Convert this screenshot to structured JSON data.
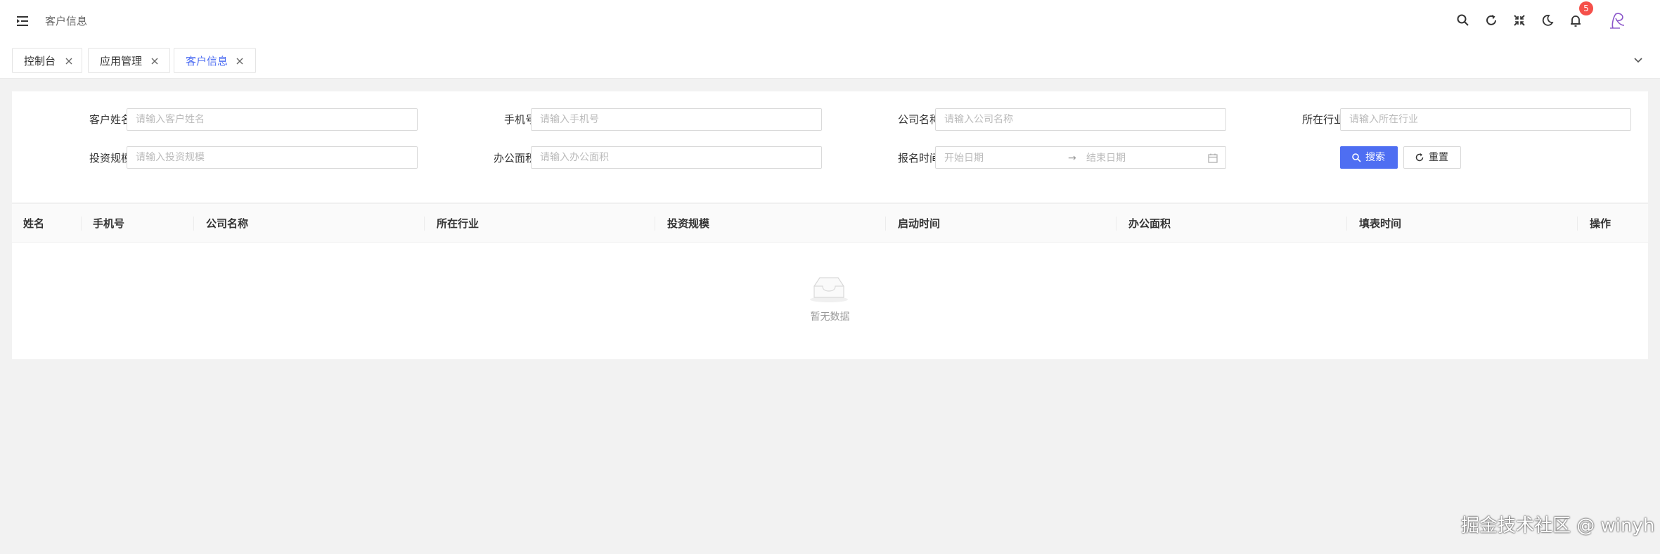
{
  "header": {
    "breadcrumb": "客户信息",
    "notification_count": "5",
    "icons": [
      "menu-fold-icon",
      "search-icon",
      "refresh-icon",
      "fullscreen-icon",
      "dark-mode-icon",
      "bell-icon"
    ]
  },
  "tabs": [
    {
      "label": "控制台",
      "active": false
    },
    {
      "label": "应用管理",
      "active": false
    },
    {
      "label": "客户信息",
      "active": true
    }
  ],
  "form": {
    "fields": [
      {
        "label": "客户姓名:",
        "placeholder": "请输入客户姓名"
      },
      {
        "label": "手机号:",
        "placeholder": "请输入手机号"
      },
      {
        "label": "公司名称:",
        "placeholder": "请输入公司名称"
      },
      {
        "label": "所在行业:",
        "placeholder": "请输入所在行业"
      },
      {
        "label": "投资规模:",
        "placeholder": "请输入投资规模"
      },
      {
        "label": "办公面积:",
        "placeholder": "请输入办公面积"
      }
    ],
    "date_range": {
      "label": "报名时间:",
      "start_placeholder": "开始日期",
      "separator": "→",
      "end_placeholder": "结束日期"
    },
    "search_label": "搜索",
    "reset_label": "重置"
  },
  "table": {
    "columns": [
      "姓名",
      "手机号",
      "公司名称",
      "所在行业",
      "投资规模",
      "启动时间",
      "办公面积",
      "填表时间",
      "操作"
    ],
    "rows": [],
    "empty_text": "暂无数据"
  },
  "watermark": "掘金技术社区 @ winyh",
  "colors": {
    "primary": "#4e6ef2",
    "badge": "#f5504a",
    "background": "#f2f2f2"
  }
}
